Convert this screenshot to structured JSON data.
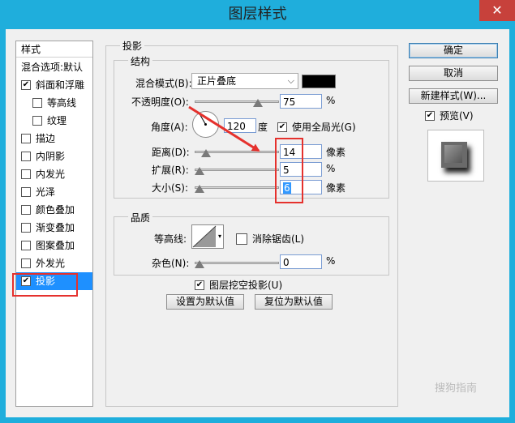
{
  "window": {
    "title": "图层样式",
    "close_label": "✕"
  },
  "styles": {
    "header": "样式",
    "blend_options": "混合选项:默认",
    "items": [
      {
        "label": "斜面和浮雕",
        "checked": true,
        "indent": false
      },
      {
        "label": "等高线",
        "checked": false,
        "indent": true
      },
      {
        "label": "纹理",
        "checked": false,
        "indent": true
      },
      {
        "label": "描边",
        "checked": false,
        "indent": false
      },
      {
        "label": "内阴影",
        "checked": false,
        "indent": false
      },
      {
        "label": "内发光",
        "checked": false,
        "indent": false
      },
      {
        "label": "光泽",
        "checked": false,
        "indent": false
      },
      {
        "label": "颜色叠加",
        "checked": false,
        "indent": false
      },
      {
        "label": "渐变叠加",
        "checked": false,
        "indent": false
      },
      {
        "label": "图案叠加",
        "checked": false,
        "indent": false
      },
      {
        "label": "外发光",
        "checked": false,
        "indent": false
      },
      {
        "label": "投影",
        "checked": true,
        "indent": false,
        "selected": true
      }
    ]
  },
  "drop_shadow": {
    "section_title": "投影",
    "structure": {
      "title": "结构",
      "blend_mode_label": "混合模式(B):",
      "blend_mode_value": "正片叠底",
      "shadow_color": "#000000",
      "opacity_label": "不透明度(O):",
      "opacity_value": "75",
      "opacity_level": 75,
      "opacity_unit": "%",
      "angle_label": "角度(A):",
      "angle_value": "120",
      "angle_unit": "度",
      "global_light_label": "使用全局光(G)",
      "global_light_checked": true,
      "distance_label": "距离(D):",
      "distance_value": "14",
      "distance_unit": "像素",
      "spread_label": "扩展(R):",
      "spread_value": "5",
      "spread_unit": "%",
      "size_label": "大小(S):",
      "size_value": "6",
      "size_unit": "像素"
    },
    "quality": {
      "title": "品质",
      "contour_label": "等高线:",
      "antialias_label": "消除锯齿(L)",
      "antialias_checked": false,
      "noise_label": "杂色(N):",
      "noise_value": "0",
      "noise_unit": "%"
    },
    "knockout_label": "图层挖空投影(U)",
    "knockout_checked": true,
    "set_default_label": "设置为默认值",
    "reset_default_label": "复位为默认值"
  },
  "actions": {
    "ok_label": "确定",
    "cancel_label": "取消",
    "new_style_label": "新建样式(W)...",
    "preview_label": "预览(V)",
    "preview_checked": true
  },
  "watermark": "搜狗指南"
}
